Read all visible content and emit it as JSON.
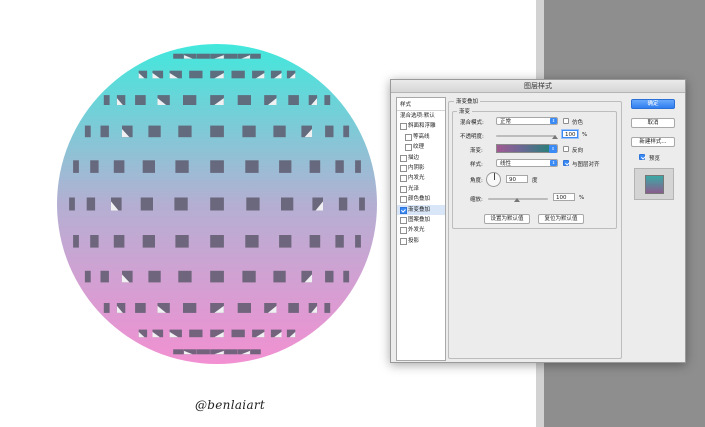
{
  "watermark": "@benlaiart",
  "colors": {
    "sphere_top": "#41e8dc",
    "sphere_mid": "#b4afd2",
    "sphere_bottom": "#f290d2",
    "hole": "#5e5a6e",
    "accent": "#3b8bf7"
  },
  "dialog": {
    "title": "图层样式",
    "style_list": {
      "header": "样式",
      "blend_options": "混合选项:默认",
      "items": [
        {
          "label": "斜面和浮雕",
          "checked": false,
          "indent": false
        },
        {
          "label": "等高线",
          "checked": false,
          "indent": true
        },
        {
          "label": "纹理",
          "checked": false,
          "indent": true
        },
        {
          "label": "描边",
          "checked": false,
          "indent": false
        },
        {
          "label": "内阴影",
          "checked": false,
          "indent": false
        },
        {
          "label": "内发光",
          "checked": false,
          "indent": false
        },
        {
          "label": "光泽",
          "checked": false,
          "indent": false
        },
        {
          "label": "颜色叠加",
          "checked": false,
          "indent": false
        },
        {
          "label": "渐变叠加",
          "checked": true,
          "indent": false
        },
        {
          "label": "图案叠加",
          "checked": false,
          "indent": false
        },
        {
          "label": "外发光",
          "checked": false,
          "indent": false
        },
        {
          "label": "投影",
          "checked": false,
          "indent": false
        }
      ]
    },
    "panel": {
      "section_title": "渐变叠加",
      "group_title": "渐变",
      "blend_mode_label": "混合模式:",
      "blend_mode_value": "正常",
      "dither_label": "仿色",
      "opacity_label": "不透明度:",
      "opacity_value": "100",
      "opacity_unit": "%",
      "gradient_label": "渐变:",
      "reverse_label": "反向",
      "style_label": "样式:",
      "style_value": "线性",
      "align_label": "与图层对齐",
      "angle_label": "角度:",
      "angle_value": "90",
      "angle_unit": "度",
      "scale_label": "缩放:",
      "scale_value": "100",
      "scale_unit": "%",
      "make_default": "设置为默认值",
      "reset_default": "复位为默认值"
    },
    "buttons": {
      "ok": "确定",
      "cancel": "取消",
      "new_style": "新建样式...",
      "preview": "预览"
    }
  }
}
